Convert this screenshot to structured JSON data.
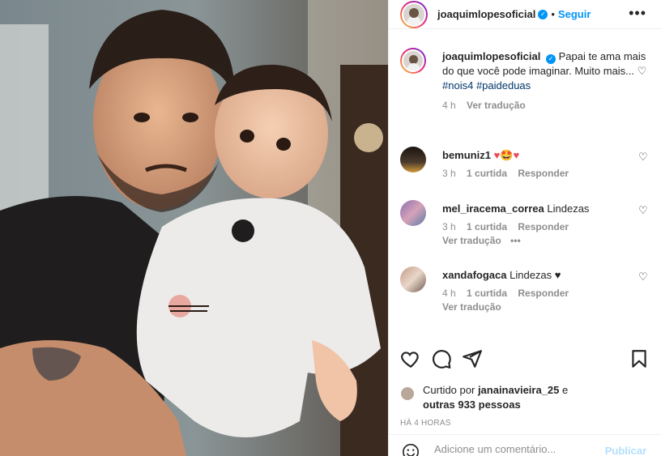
{
  "post": {
    "author": "joaquimlopesoficial",
    "follow_label": "Seguir",
    "dot": "•",
    "more_label": "•••",
    "caption": {
      "text": "Papai te ama mais do que você pode imaginar. Muito mais... ♡",
      "hashtags": [
        "#nois4",
        "#paideduas"
      ],
      "time": "4 h",
      "translate": "Ver tradução"
    }
  },
  "comments": [
    {
      "username": "bemuniz1",
      "text": "♥🤩♥",
      "time": "3 h",
      "likes": "1 curtida",
      "reply": "Responder",
      "translate": ""
    },
    {
      "username": "mel_iracema_correa",
      "text": "Lindezas",
      "time": "3 h",
      "likes": "1 curtida",
      "reply": "Responder",
      "translate": "Ver tradução",
      "extra": "•••"
    },
    {
      "username": "xandafogaca",
      "text": "Lindezas ♥",
      "time": "4 h",
      "likes": "1 curtida",
      "reply": "Responder",
      "translate": "Ver tradução"
    }
  ],
  "likes": {
    "prefix": "Curtido por",
    "user": "janainavieira_25",
    "conj": "e",
    "others": "outras 933 pessoas"
  },
  "timestamp": "HÁ 4 HORAS",
  "composer": {
    "placeholder": "Adicione um comentário...",
    "publish": "Publicar"
  },
  "colors": {
    "accent": "#0095f6",
    "hashtag": "#00376b",
    "muted": "#8e8e8e",
    "heart": "#ed4956"
  },
  "icons": [
    "verified-icon",
    "more-icon",
    "like-icon",
    "comment-icon",
    "share-icon",
    "save-icon",
    "emoji-icon"
  ]
}
